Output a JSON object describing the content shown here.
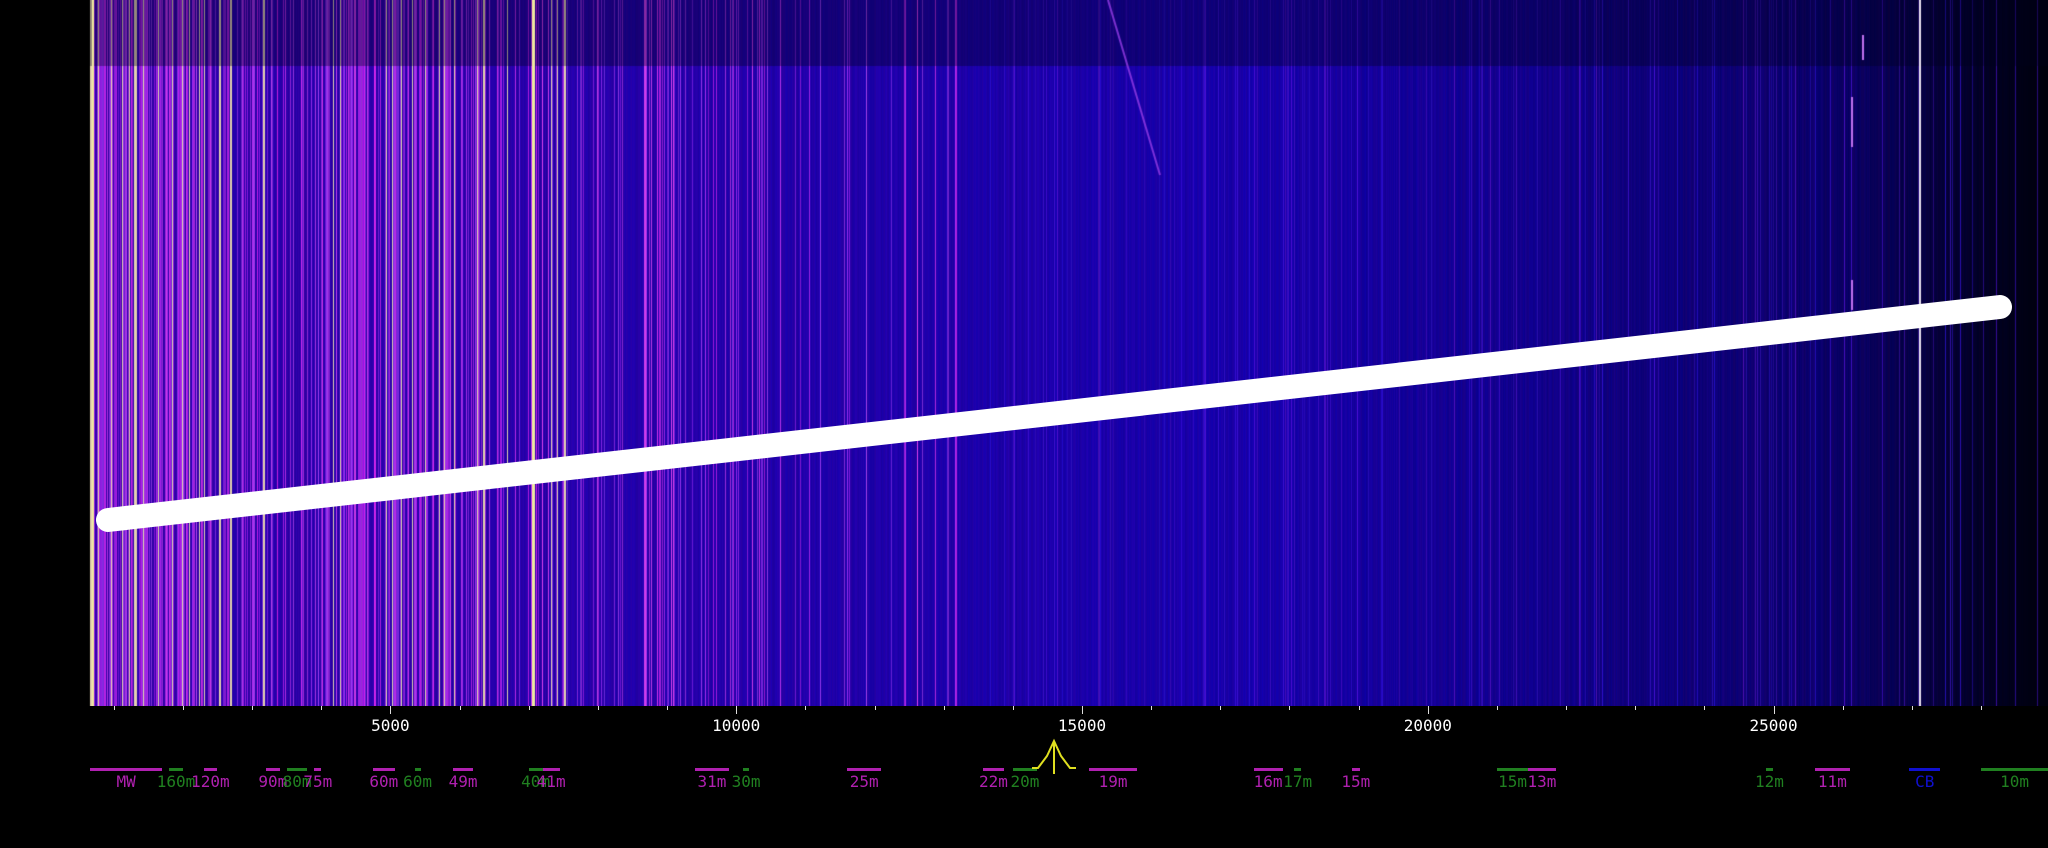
{
  "waterfall": {
    "colors": {
      "bright": "#f8e8b0",
      "violet": "#b030f0",
      "blue": "#0a0aa0",
      "dark": "#02022a"
    }
  },
  "scale": {
    "unit": "kHz",
    "labels": [
      "5000",
      "10000",
      "15000",
      "20000",
      "25000"
    ],
    "label_values": [
      5000,
      10000,
      15000,
      20000,
      25000
    ],
    "minor_step": 1000
  },
  "passband_marker": {
    "freq_khz": 14600,
    "color": "#e0e020"
  },
  "bands": [
    {
      "label": "MW",
      "from": 0,
      "to": 1700,
      "color": "#b020b0"
    },
    {
      "label": "160m",
      "from": 1800,
      "to": 2000,
      "color": "#208020"
    },
    {
      "label": "120m",
      "from": 2300,
      "to": 2495,
      "color": "#b020b0"
    },
    {
      "label": "90m",
      "from": 3200,
      "to": 3400,
      "color": "#b020b0"
    },
    {
      "label": "80m",
      "from": 3500,
      "to": 3800,
      "color": "#208020"
    },
    {
      "label": "75m",
      "from": 3900,
      "to": 4000,
      "color": "#b020b0"
    },
    {
      "label": "60m",
      "from": 4750,
      "to": 5060,
      "color": "#b020b0"
    },
    {
      "label": "60m",
      "from": 5350,
      "to": 5367,
      "color": "#208020"
    },
    {
      "label": "49m",
      "from": 5900,
      "to": 6200,
      "color": "#b020b0"
    },
    {
      "label": "40m",
      "from": 7000,
      "to": 7200,
      "color": "#208020"
    },
    {
      "label": "41m",
      "from": 7200,
      "to": 7450,
      "color": "#b020b0"
    },
    {
      "label": "31m",
      "from": 9400,
      "to": 9900,
      "color": "#b020b0"
    },
    {
      "label": "30m",
      "from": 10100,
      "to": 10150,
      "color": "#208020"
    },
    {
      "label": "25m",
      "from": 11600,
      "to": 12100,
      "color": "#b020b0"
    },
    {
      "label": "22m",
      "from": 13570,
      "to": 13870,
      "color": "#b020b0"
    },
    {
      "label": "20m",
      "from": 14000,
      "to": 14350,
      "color": "#208020"
    },
    {
      "label": "19m",
      "from": 15100,
      "to": 15800,
      "color": "#b020b0"
    },
    {
      "label": "16m",
      "from": 17480,
      "to": 17900,
      "color": "#b020b0"
    },
    {
      "label": "17m",
      "from": 18068,
      "to": 18168,
      "color": "#208020"
    },
    {
      "label": "15m",
      "from": 18900,
      "to": 19020,
      "color": "#b020b0"
    },
    {
      "label": "15m",
      "from": 21000,
      "to": 21450,
      "color": "#208020"
    },
    {
      "label": "13m",
      "from": 21450,
      "to": 21850,
      "color": "#b020b0"
    },
    {
      "label": "12m",
      "from": 24890,
      "to": 24990,
      "color": "#208020"
    },
    {
      "label": "11m",
      "from": 25600,
      "to": 26100,
      "color": "#b020b0"
    },
    {
      "label": "CB",
      "from": 26965,
      "to": 27405,
      "color": "#1010d0"
    },
    {
      "label": "10m",
      "from": 28000,
      "to": 29700,
      "color": "#208020"
    }
  ],
  "annotation_stroke": {
    "color": "#ffffff"
  }
}
